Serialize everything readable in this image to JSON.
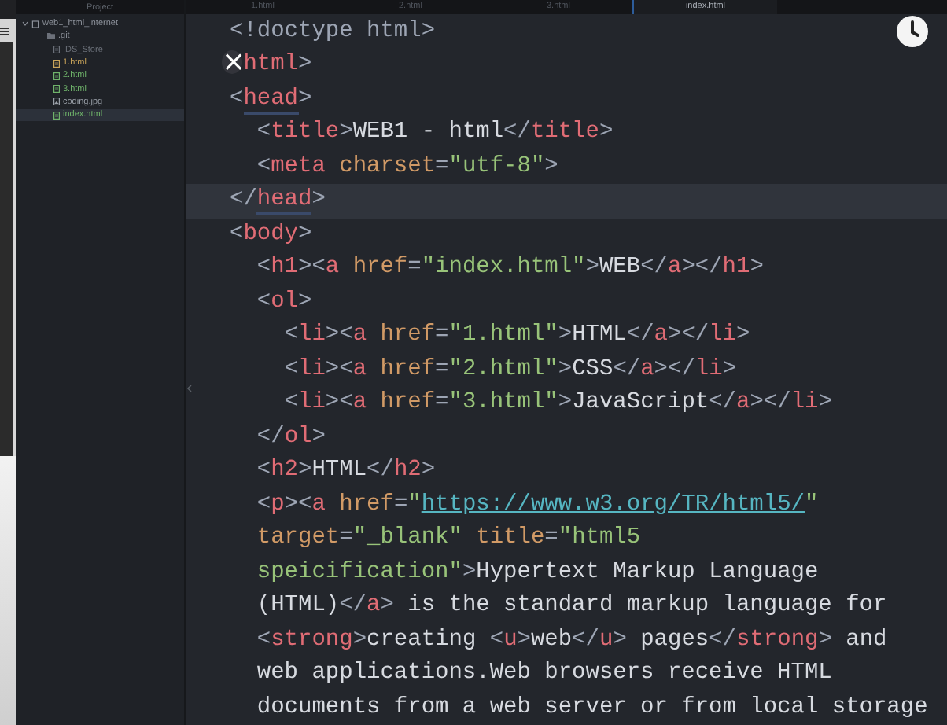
{
  "sidebar": {
    "title": "Project",
    "root": "web1_html_internet",
    "items": [
      {
        "name": ".git",
        "kind": "folder",
        "color": "#8a8f98",
        "selected": false
      },
      {
        "name": ".DS_Store",
        "kind": "file",
        "color": "#6b7079",
        "selected": false
      },
      {
        "name": "1.html",
        "kind": "file",
        "color": "#c9a45a",
        "selected": false
      },
      {
        "name": "2.html",
        "kind": "file",
        "color": "#6fb36a",
        "selected": false
      },
      {
        "name": "3.html",
        "kind": "file",
        "color": "#6fb36a",
        "selected": false
      },
      {
        "name": "coding.jpg",
        "kind": "image",
        "color": "#9aa0a8",
        "selected": false
      },
      {
        "name": "index.html",
        "kind": "file",
        "color": "#6fb36a",
        "selected": true
      }
    ]
  },
  "tabs": [
    {
      "label": "1.html",
      "selected": false
    },
    {
      "label": "2.html",
      "selected": false
    },
    {
      "label": "3.html",
      "selected": false
    },
    {
      "label": "index.html",
      "selected": true
    }
  ],
  "close_glyph": "×",
  "lines": [
    {
      "current": false,
      "matched": false,
      "tokens": [
        {
          "kind": "p",
          "text": "<!doctype html>"
        }
      ]
    },
    {
      "current": false,
      "matched": false,
      "covered": true,
      "tokens": [
        {
          "kind": "t",
          "text": "html"
        },
        {
          "kind": "p",
          "text": ">"
        }
      ]
    },
    {
      "current": false,
      "matched": true,
      "tokens": [
        {
          "kind": "p",
          "text": "<"
        },
        {
          "kind": "t",
          "text": "head"
        },
        {
          "kind": "p",
          "text": ">"
        }
      ]
    },
    {
      "current": false,
      "matched": false,
      "tokens": [
        {
          "kind": "p",
          "text": "  <"
        },
        {
          "kind": "t",
          "text": "title"
        },
        {
          "kind": "p",
          "text": ">"
        },
        {
          "kind": "x",
          "text": "WEB1 - html"
        },
        {
          "kind": "p",
          "text": "</"
        },
        {
          "kind": "t",
          "text": "title"
        },
        {
          "kind": "p",
          "text": ">"
        }
      ]
    },
    {
      "current": false,
      "matched": false,
      "tokens": [
        {
          "kind": "p",
          "text": "  <"
        },
        {
          "kind": "t",
          "text": "meta"
        },
        {
          "kind": "a",
          "text": " charset"
        },
        {
          "kind": "p",
          "text": "="
        },
        {
          "kind": "s",
          "text": "\"utf-8\""
        },
        {
          "kind": "p",
          "text": ">"
        }
      ]
    },
    {
      "current": true,
      "matched": true,
      "tokens": [
        {
          "kind": "p",
          "text": "</"
        },
        {
          "kind": "t",
          "text": "head"
        },
        {
          "kind": "p",
          "text": ">"
        }
      ]
    },
    {
      "current": false,
      "matched": false,
      "tokens": [
        {
          "kind": "p",
          "text": "<"
        },
        {
          "kind": "t",
          "text": "body"
        },
        {
          "kind": "p",
          "text": ">"
        }
      ]
    },
    {
      "current": false,
      "matched": false,
      "tokens": [
        {
          "kind": "p",
          "text": "  <"
        },
        {
          "kind": "t",
          "text": "h1"
        },
        {
          "kind": "p",
          "text": "><"
        },
        {
          "kind": "t",
          "text": "a"
        },
        {
          "kind": "a",
          "text": " href"
        },
        {
          "kind": "p",
          "text": "="
        },
        {
          "kind": "s",
          "text": "\"index.html\""
        },
        {
          "kind": "p",
          "text": ">"
        },
        {
          "kind": "x",
          "text": "WEB"
        },
        {
          "kind": "p",
          "text": "</"
        },
        {
          "kind": "t",
          "text": "a"
        },
        {
          "kind": "p",
          "text": "></"
        },
        {
          "kind": "t",
          "text": "h1"
        },
        {
          "kind": "p",
          "text": ">"
        }
      ]
    },
    {
      "current": false,
      "matched": false,
      "tokens": [
        {
          "kind": "p",
          "text": "  <"
        },
        {
          "kind": "t",
          "text": "ol"
        },
        {
          "kind": "p",
          "text": ">"
        }
      ]
    },
    {
      "current": false,
      "matched": false,
      "tokens": [
        {
          "kind": "p",
          "text": "    <"
        },
        {
          "kind": "t",
          "text": "li"
        },
        {
          "kind": "p",
          "text": "><"
        },
        {
          "kind": "t",
          "text": "a"
        },
        {
          "kind": "a",
          "text": " href"
        },
        {
          "kind": "p",
          "text": "="
        },
        {
          "kind": "s",
          "text": "\"1.html\""
        },
        {
          "kind": "p",
          "text": ">"
        },
        {
          "kind": "x",
          "text": "HTML"
        },
        {
          "kind": "p",
          "text": "</"
        },
        {
          "kind": "t",
          "text": "a"
        },
        {
          "kind": "p",
          "text": "></"
        },
        {
          "kind": "t",
          "text": "li"
        },
        {
          "kind": "p",
          "text": ">"
        }
      ]
    },
    {
      "current": false,
      "matched": false,
      "tokens": [
        {
          "kind": "p",
          "text": "    <"
        },
        {
          "kind": "t",
          "text": "li"
        },
        {
          "kind": "p",
          "text": "><"
        },
        {
          "kind": "t",
          "text": "a"
        },
        {
          "kind": "a",
          "text": " href"
        },
        {
          "kind": "p",
          "text": "="
        },
        {
          "kind": "s",
          "text": "\"2.html\""
        },
        {
          "kind": "p",
          "text": ">"
        },
        {
          "kind": "x",
          "text": "CSS"
        },
        {
          "kind": "p",
          "text": "</"
        },
        {
          "kind": "t",
          "text": "a"
        },
        {
          "kind": "p",
          "text": "></"
        },
        {
          "kind": "t",
          "text": "li"
        },
        {
          "kind": "p",
          "text": ">"
        }
      ]
    },
    {
      "current": false,
      "matched": false,
      "tokens": [
        {
          "kind": "p",
          "text": "    <"
        },
        {
          "kind": "t",
          "text": "li"
        },
        {
          "kind": "p",
          "text": "><"
        },
        {
          "kind": "t",
          "text": "a"
        },
        {
          "kind": "a",
          "text": " href"
        },
        {
          "kind": "p",
          "text": "="
        },
        {
          "kind": "s",
          "text": "\"3.html\""
        },
        {
          "kind": "p",
          "text": ">"
        },
        {
          "kind": "x",
          "text": "JavaScript"
        },
        {
          "kind": "p",
          "text": "</"
        },
        {
          "kind": "t",
          "text": "a"
        },
        {
          "kind": "p",
          "text": "></"
        },
        {
          "kind": "t",
          "text": "li"
        },
        {
          "kind": "p",
          "text": ">"
        }
      ]
    },
    {
      "current": false,
      "matched": false,
      "tokens": [
        {
          "kind": "p",
          "text": "  </"
        },
        {
          "kind": "t",
          "text": "ol"
        },
        {
          "kind": "p",
          "text": ">"
        }
      ]
    },
    {
      "current": false,
      "matched": false,
      "tokens": [
        {
          "kind": "p",
          "text": "  <"
        },
        {
          "kind": "t",
          "text": "h2"
        },
        {
          "kind": "p",
          "text": ">"
        },
        {
          "kind": "x",
          "text": "HTML"
        },
        {
          "kind": "p",
          "text": "</"
        },
        {
          "kind": "t",
          "text": "h2"
        },
        {
          "kind": "p",
          "text": ">"
        }
      ]
    },
    {
      "current": false,
      "matched": false,
      "tokens": [
        {
          "kind": "p",
          "text": "  <"
        },
        {
          "kind": "t",
          "text": "p"
        },
        {
          "kind": "p",
          "text": "><"
        },
        {
          "kind": "t",
          "text": "a"
        },
        {
          "kind": "a",
          "text": " href"
        },
        {
          "kind": "p",
          "text": "="
        },
        {
          "kind": "s",
          "text": "\""
        },
        {
          "kind": "l",
          "text": "https://www.w3.org/TR/html5/"
        },
        {
          "kind": "s",
          "text": "\""
        }
      ]
    },
    {
      "current": false,
      "matched": false,
      "tokens": [
        {
          "kind": "a",
          "text": "  target"
        },
        {
          "kind": "p",
          "text": "="
        },
        {
          "kind": "s",
          "text": "\"_blank\""
        },
        {
          "kind": "a",
          "text": " title"
        },
        {
          "kind": "p",
          "text": "="
        },
        {
          "kind": "s",
          "text": "\"html5"
        }
      ]
    },
    {
      "current": false,
      "matched": false,
      "tokens": [
        {
          "kind": "s",
          "text": "  speicification\""
        },
        {
          "kind": "p",
          "text": ">"
        },
        {
          "kind": "x",
          "text": "Hypertext Markup Language"
        }
      ]
    },
    {
      "current": false,
      "matched": false,
      "tokens": [
        {
          "kind": "x",
          "text": "  (HTML)"
        },
        {
          "kind": "p",
          "text": "</"
        },
        {
          "kind": "t",
          "text": "a"
        },
        {
          "kind": "p",
          "text": ">"
        },
        {
          "kind": "x",
          "text": " is the standard markup language for"
        }
      ]
    },
    {
      "current": false,
      "matched": false,
      "tokens": [
        {
          "kind": "p",
          "text": "  <"
        },
        {
          "kind": "t",
          "text": "strong"
        },
        {
          "kind": "p",
          "text": ">"
        },
        {
          "kind": "x",
          "text": "creating "
        },
        {
          "kind": "p",
          "text": "<"
        },
        {
          "kind": "t",
          "text": "u"
        },
        {
          "kind": "p",
          "text": ">"
        },
        {
          "kind": "x",
          "text": "web"
        },
        {
          "kind": "p",
          "text": "</"
        },
        {
          "kind": "t",
          "text": "u"
        },
        {
          "kind": "p",
          "text": ">"
        },
        {
          "kind": "x",
          "text": " pages"
        },
        {
          "kind": "p",
          "text": "</"
        },
        {
          "kind": "t",
          "text": "strong"
        },
        {
          "kind": "p",
          "text": ">"
        },
        {
          "kind": "x",
          "text": " and"
        }
      ]
    },
    {
      "current": false,
      "matched": false,
      "tokens": [
        {
          "kind": "x",
          "text": "  web applications.Web browsers receive HTML"
        }
      ]
    },
    {
      "current": false,
      "matched": false,
      "tokens": [
        {
          "kind": "x",
          "text": "  documents from a web server or from local storage"
        }
      ]
    }
  ]
}
